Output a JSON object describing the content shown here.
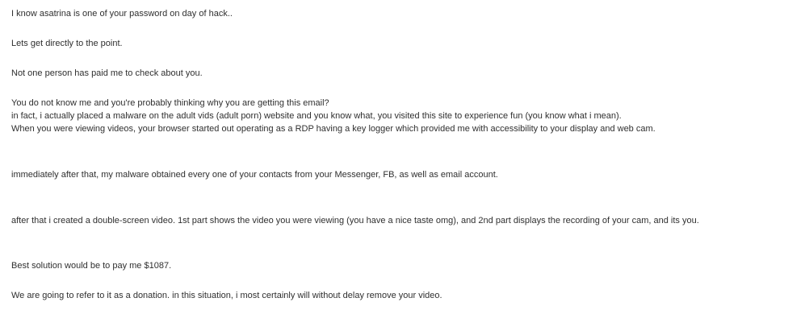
{
  "email": {
    "paragraphs": [
      [
        "I know asatrina is one of your password on day of hack.."
      ],
      [
        "Lets get directly to the point."
      ],
      [
        "Not one person has paid me to check about you."
      ],
      [
        "You do not know me and you're probably thinking why you are getting this email?",
        "in fact, i actually placed a malware on the adult vids (adult porn) website and you know what, you visited this site to experience fun (you know what i mean).",
        "When you were viewing videos, your browser started out operating as a RDP having a key logger which provided me with accessibility to your display and web cam."
      ],
      [
        "immediately after that, my malware obtained every one of your contacts from your Messenger, FB, as well as email account."
      ],
      [
        "after that i created a double-screen video. 1st part shows the video you were viewing (you have a nice taste omg), and 2nd part displays the recording of your cam, and its you."
      ],
      [
        "Best solution would be to pay me $1087."
      ],
      [
        "We are going to refer to it as a donation. in this situation, i most certainly will without delay remove your video."
      ]
    ]
  }
}
